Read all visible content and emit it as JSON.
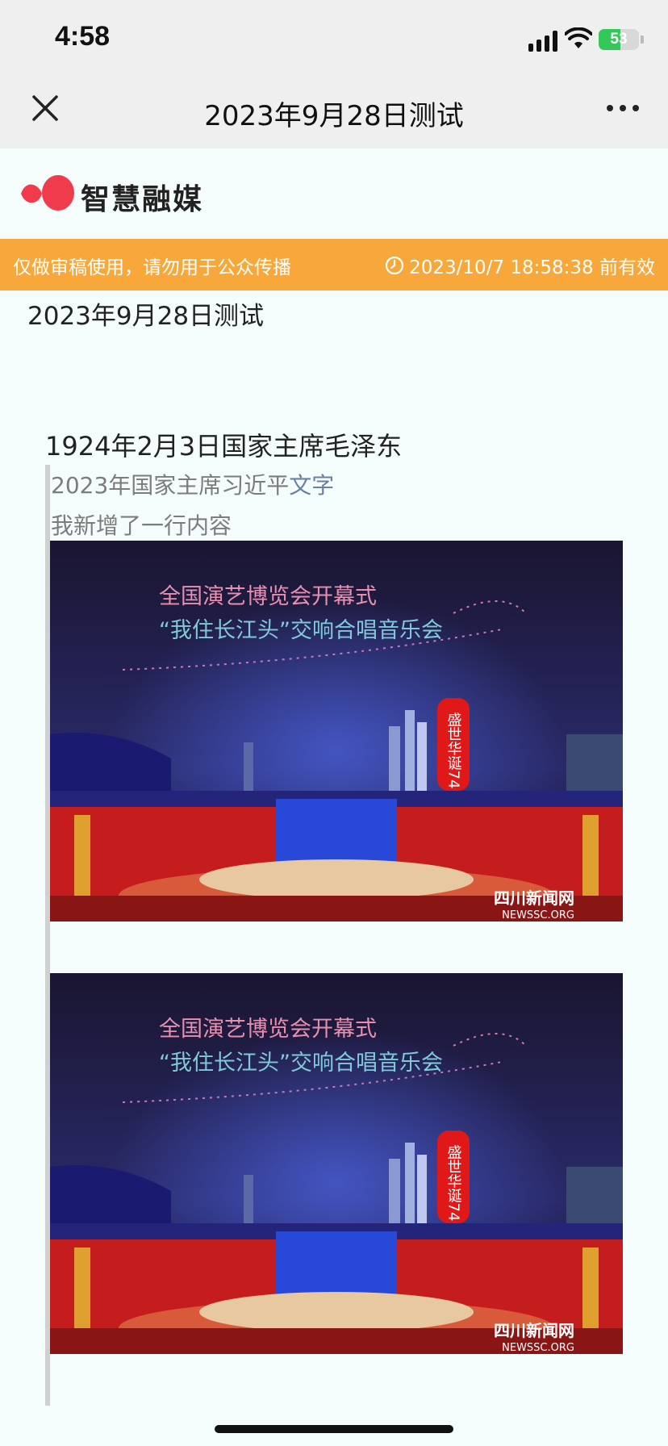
{
  "status_bar": {
    "time": "4:58",
    "battery_percent": "53",
    "battery_level": 0.53,
    "icons": [
      "signal-icon",
      "wifi-icon",
      "battery-icon"
    ]
  },
  "nav": {
    "title": "2023年9月28日测试",
    "close_icon": "close-icon",
    "more_icon": "more-icon"
  },
  "brand": {
    "name": "智慧融媒"
  },
  "banner": {
    "notice": "仅做审稿使用，请勿用于公众传播",
    "validity": "2023/10/7 18:58:38 前有效",
    "color": "#f8a83a"
  },
  "article": {
    "title": "2023年9月28日测试",
    "paragraph": "1924年2月3日国家主席毛泽东",
    "quote": {
      "line1_text": "2023年国家主席习近平",
      "line1_link": "文字",
      "line2": "我新增了一行内容"
    },
    "images": [
      {
        "sky_text_1": "全国演艺博览会开幕式",
        "sky_text_2": "“我住长江头”交响合唱音乐会",
        "tower_text": "盛世华诞74",
        "watermark_cn": "四川新闻网",
        "watermark_en": "NEWSSC.ORG"
      },
      {
        "sky_text_1": "全国演艺博览会开幕式",
        "sky_text_2": "“我住长江头”交响合唱音乐会",
        "tower_text": "盛世华诞74",
        "watermark_cn": "四川新闻网",
        "watermark_en": "NEWSSC.ORG"
      }
    ]
  }
}
